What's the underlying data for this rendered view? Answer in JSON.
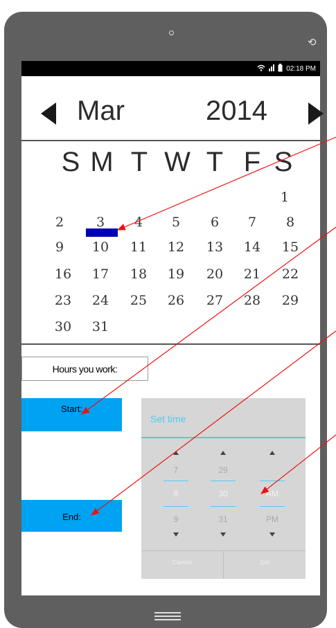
{
  "status_bar": {
    "time": "02:18 PM"
  },
  "calendar": {
    "month": "Mar",
    "year": "2014",
    "weekdays": [
      "S",
      "M",
      "T",
      "W",
      "T",
      "F",
      "S"
    ],
    "weeks": [
      [
        "",
        "",
        "",
        "",
        "",
        "",
        "1"
      ],
      [
        "2",
        "3",
        "4",
        "5",
        "6",
        "7",
        "8"
      ],
      [
        "9",
        "10",
        "11",
        "12",
        "13",
        "14",
        "15"
      ],
      [
        "16",
        "17",
        "18",
        "19",
        "20",
        "21",
        "22"
      ],
      [
        "23",
        "24",
        "25",
        "26",
        "27",
        "28",
        "29"
      ],
      [
        "30",
        "31",
        "",
        "",
        "",
        "",
        ""
      ]
    ]
  },
  "hours_label": "Hours you work:",
  "start_button": "Start:",
  "end_button": "End:",
  "time_picker": {
    "title": "Set time",
    "hour": {
      "prev": "7",
      "current": "8",
      "next": "9"
    },
    "minute": {
      "prev": "29",
      "current": "30",
      "next": "31"
    },
    "ampm": {
      "prev": "",
      "current": "AM",
      "next": "PM"
    },
    "cancel": "Cancel",
    "set": "Set"
  },
  "colors": {
    "accent_blue": "#00a2f2",
    "picker_cyan": "#4ecbf0",
    "today_marker": "#0000b3",
    "annotation_red": "#ee1111"
  }
}
